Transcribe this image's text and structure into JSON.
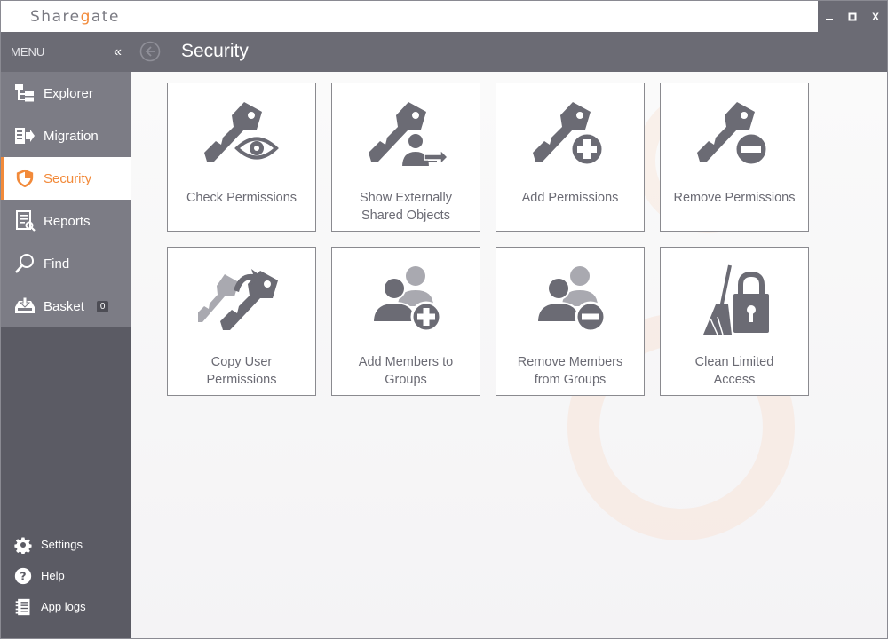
{
  "app": {
    "logo_prefix": "Share",
    "logo_g": "g",
    "logo_suffix": "ate"
  },
  "window_controls": {
    "minimize": "_",
    "maximize": "▫",
    "close": "X"
  },
  "sidebar": {
    "menu_label": "MENU",
    "collapse_glyph": "«",
    "items": [
      {
        "label": "Explorer",
        "icon": "explorer-icon"
      },
      {
        "label": "Migration",
        "icon": "migration-icon"
      },
      {
        "label": "Security",
        "icon": "shield-icon",
        "active": true
      },
      {
        "label": "Reports",
        "icon": "reports-icon"
      },
      {
        "label": "Find",
        "icon": "search-icon"
      },
      {
        "label": "Basket",
        "icon": "basket-icon",
        "badge": "0"
      }
    ],
    "bottom": [
      {
        "label": "Settings",
        "icon": "gear-icon"
      },
      {
        "label": "Help",
        "icon": "help-icon"
      },
      {
        "label": "App logs",
        "icon": "logs-icon"
      }
    ]
  },
  "header": {
    "title": "Security"
  },
  "tiles": [
    {
      "line1": "Check Permissions",
      "line2": "",
      "icon": "key-eye-icon"
    },
    {
      "line1": "Show Externally",
      "line2": "Shared Objects",
      "icon": "key-user-share-icon"
    },
    {
      "line1": "Add Permissions",
      "line2": "",
      "icon": "key-plus-icon"
    },
    {
      "line1": "Remove Permissions",
      "line2": "",
      "icon": "key-minus-icon"
    },
    {
      "line1": "Copy User",
      "line2": "Permissions",
      "icon": "copy-keys-icon"
    },
    {
      "line1": "Add Members to",
      "line2": "Groups",
      "icon": "group-add-icon"
    },
    {
      "line1": "Remove Members",
      "line2": "from Groups",
      "icon": "group-remove-icon"
    },
    {
      "line1": "Clean Limited",
      "line2": "Access",
      "icon": "broom-lock-icon"
    }
  ],
  "colors": {
    "accent": "#f28a3a",
    "sidebar": "#5b5b64",
    "nav_item": "#7c7c85",
    "header": "#6b6b74",
    "icon_gray": "#6b6b74"
  }
}
